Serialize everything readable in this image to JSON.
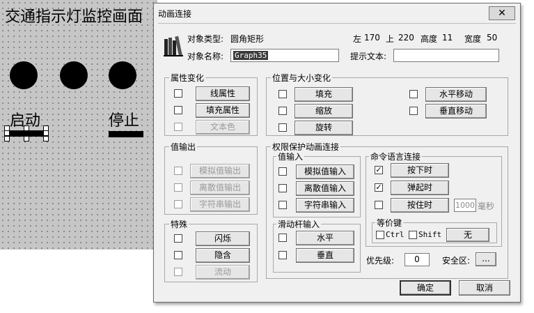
{
  "canvas": {
    "title": "交通指示灯监控画面",
    "start_label": "启动",
    "stop_label": "停止"
  },
  "dialog": {
    "title": "动画连接",
    "close_glyph": "✕",
    "object_type_label": "对象类型:",
    "object_type_value": "圆角矩形",
    "left_label": "左",
    "left_value": "170",
    "top_label": "上",
    "top_value": "220",
    "height_label": "高度",
    "height_value": "11",
    "width_label": "宽度",
    "width_value": "50",
    "object_name_label": "对象名称:",
    "object_name_value": "Graph35",
    "hint_text_label": "提示文本:",
    "hint_text_value": "",
    "groups": {
      "property": {
        "label": "属性变化",
        "items": [
          "线属性",
          "填充属性",
          "文本色"
        ]
      },
      "position": {
        "label": "位置与大小变化",
        "items": [
          "填充",
          "缩放",
          "旋转",
          "水平移动",
          "垂直移动"
        ]
      },
      "value_output": {
        "label": "值输出",
        "items": [
          "模拟值输出",
          "离散值输出",
          "字符串输出"
        ]
      },
      "special": {
        "label": "特殊",
        "items": [
          "闪烁",
          "隐含",
          "流动"
        ]
      },
      "permission": {
        "label": "权限保护动画连接"
      },
      "value_input": {
        "label": "值输入",
        "items": [
          "模拟值输入",
          "离散值输入",
          "字符串输入"
        ]
      },
      "slider": {
        "label": "滑动杆输入",
        "items": [
          "水平",
          "垂直"
        ]
      },
      "command": {
        "label": "命令语言连接",
        "items": [
          "按下时",
          "弹起时",
          "按住时"
        ],
        "press_ms_value": "1000",
        "ms_unit": "毫秒"
      },
      "hotkey": {
        "label": "等价键",
        "ctrl_label": "Ctrl",
        "shift_label": "Shift",
        "key_value": "无"
      }
    },
    "priority_label": "优先级:",
    "priority_value": "0",
    "security_label": "安全区:",
    "security_button": "...",
    "ok_label": "确定",
    "cancel_label": "取消"
  },
  "colors": {
    "canvas_bg": "#c6c6c6",
    "dialog_bg": "#f0f0f0",
    "selection_bg": "#3b3b3b"
  },
  "icons": {
    "object_icon": "books-icon",
    "check_mark": "✓"
  }
}
